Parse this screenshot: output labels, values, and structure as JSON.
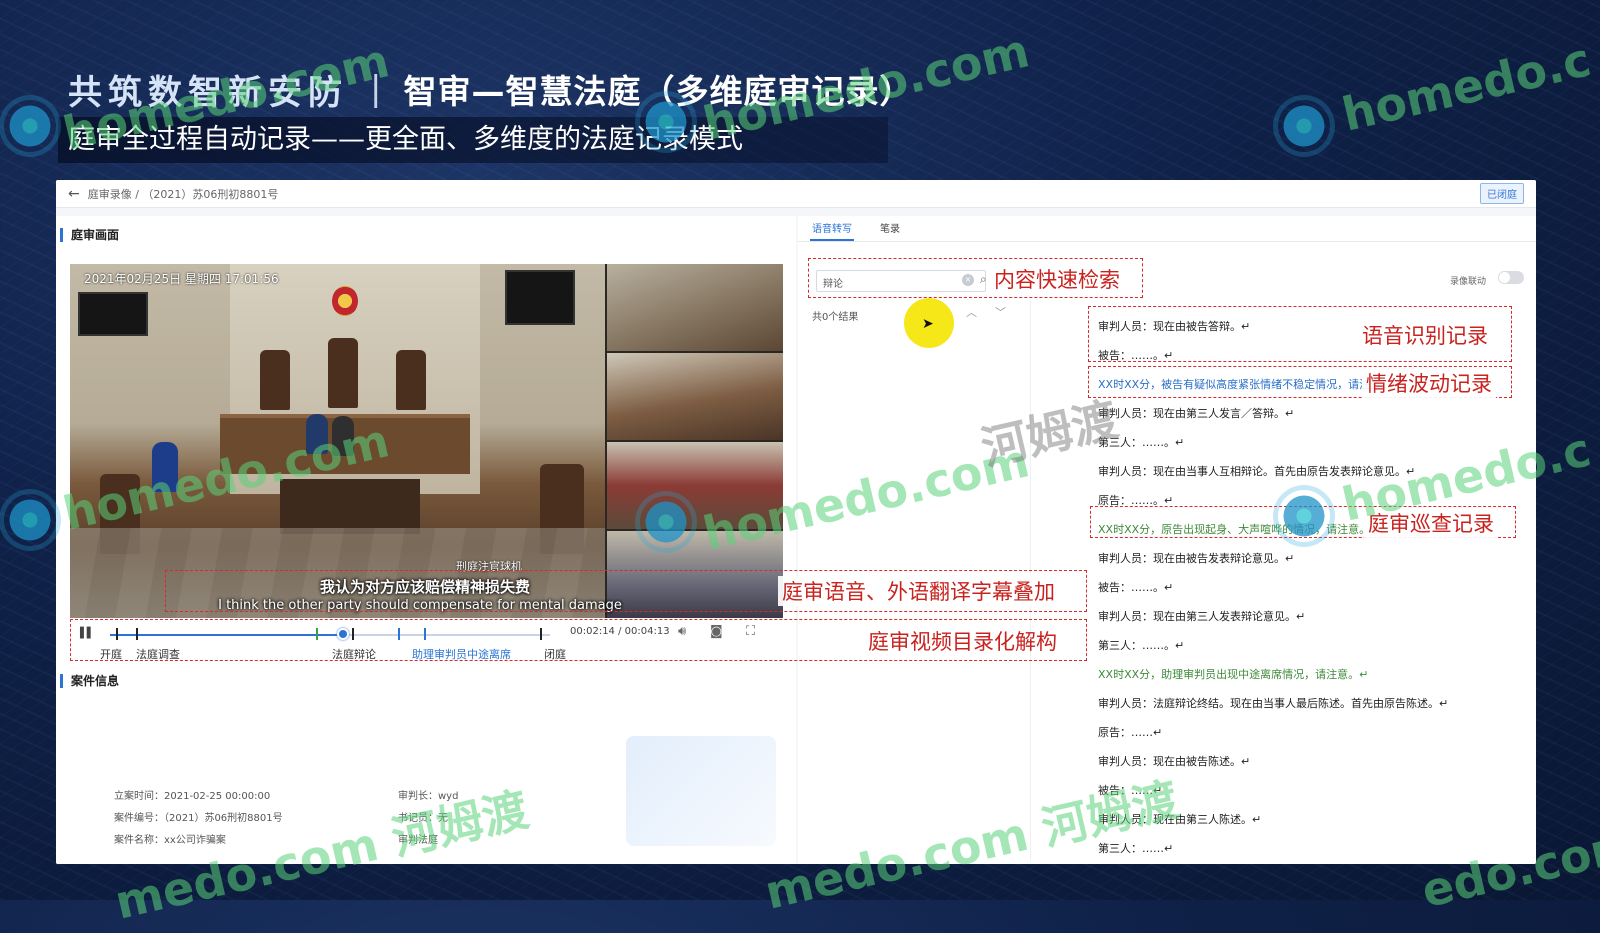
{
  "slide": {
    "brand": "共筑数智新安防",
    "separator": "|",
    "title": "智审—智慧法庭（多维庭审记录）",
    "subtitle": "庭审全过程自动记录——更全面、多维度的法庭记录模式"
  },
  "watermarks": {
    "homedo": "homedo.com",
    "homedo_short": "homedo.c",
    "hemudu": "河姆渡",
    "hemudu_full": "homedo.com 河姆渡",
    "medo_full": "medo.com 河姆渡",
    "edo": "edo.com",
    "medo": "medo.co"
  },
  "app": {
    "breadcrumb": "庭审录像 /  （2021）苏06刑初8801号",
    "closed_button": "已闭庭",
    "left": {
      "section_video": "庭审画面",
      "timestamp": "2021年02月25日  星期四  17:01:56",
      "scene_label": "刑庭注官球机",
      "subtitle_zh": "我认为对方应该赔偿精神损失费",
      "subtitle_en": "I think the other party should compensate for mental damage",
      "player": {
        "pause_icon": "pause-icon",
        "time": "00:02:14 / 00:04:13",
        "progress_fraction": 0.53,
        "chapters": [
          {
            "label": "开庭",
            "blue": false
          },
          {
            "label": "法庭调查",
            "blue": false
          },
          {
            "label": "法庭辩论",
            "blue": false
          },
          {
            "label": "助理审判员中途离席",
            "blue": true
          },
          {
            "label": "闭庭",
            "blue": false
          }
        ]
      },
      "section_case": "案件信息",
      "case": {
        "filed_time_label": "立案时间：2021-02-25 00:00:00",
        "chief_judge_label": "审判长：wyd",
        "case_no_label": "案件编号：（2021）苏06刑初8801号",
        "clerk_label": "书记员：无",
        "case_name_label": "案件名称：xx公司诈骗案",
        "court_label": "审判法庭"
      }
    },
    "right": {
      "tabs": [
        {
          "label": "语音转写",
          "active": true
        },
        {
          "label": "笔录",
          "active": false
        }
      ],
      "search": {
        "value": "辩论"
      },
      "result_count": "共0个结果",
      "record_link_label": "录像联动",
      "record_link_on": false,
      "transcript": [
        {
          "text": "审判人员：现在由被告答辩。↵",
          "type": "normal"
        },
        {
          "text": "被告：……。↵",
          "type": "normal"
        },
        {
          "text": "XX时XX分，被告有疑似高度紧张情绪不稳定情况，请注意。",
          "type": "emo"
        },
        {
          "text": "审判人员：现在由第三人发言／答辩。↵",
          "type": "normal"
        },
        {
          "text": "第三人：……。↵",
          "type": "normal"
        },
        {
          "text": "审判人员：现在由当事人互相辩论。首先由原告发表辩论意见。↵",
          "type": "normal"
        },
        {
          "text": "原告：……。↵",
          "type": "normal"
        },
        {
          "text": "XX时XX分，原告出现起身、大声喧哗的情况，请注意。",
          "type": "patrol"
        },
        {
          "text": "审判人员：现在由被告发表辩论意见。↵",
          "type": "normal"
        },
        {
          "text": "被告：……。↵",
          "type": "normal"
        },
        {
          "text": "审判人员：现在由第三人发表辩论意见。↵",
          "type": "normal"
        },
        {
          "text": "第三人：……。↵",
          "type": "normal"
        },
        {
          "text": "XX时XX分，助理审判员出现中途离席情况，请注意。↵",
          "type": "patrol"
        },
        {
          "text": "审判人员：法庭辩论终结。现在由当事人最后陈述。首先由原告陈述。↵",
          "type": "normal"
        },
        {
          "text": "原告：……↵",
          "type": "normal"
        },
        {
          "text": "审判人员：现在由被告陈述。↵",
          "type": "normal"
        },
        {
          "text": "被告：……↵",
          "type": "normal"
        },
        {
          "text": "审判人员：现在由第三人陈述。↵",
          "type": "normal"
        },
        {
          "text": "第三人：……↵",
          "type": "normal"
        }
      ]
    }
  },
  "annotations": {
    "search": "内容快速检索",
    "speech": "语音识别记录",
    "emotion": "情绪波动记录",
    "patrol": "庭审巡查记录",
    "subtitle_overlay": "庭审语音、外语翻译字幕叠加",
    "video_index": "庭审视频目录化解构"
  },
  "colors": {
    "accent": "#2a74d6",
    "annotation_red": "#d62b2b",
    "emotion_blue": "#2a6fc9",
    "patrol_green": "#3f8a3a",
    "cursor_highlight": "#f4e60c"
  }
}
